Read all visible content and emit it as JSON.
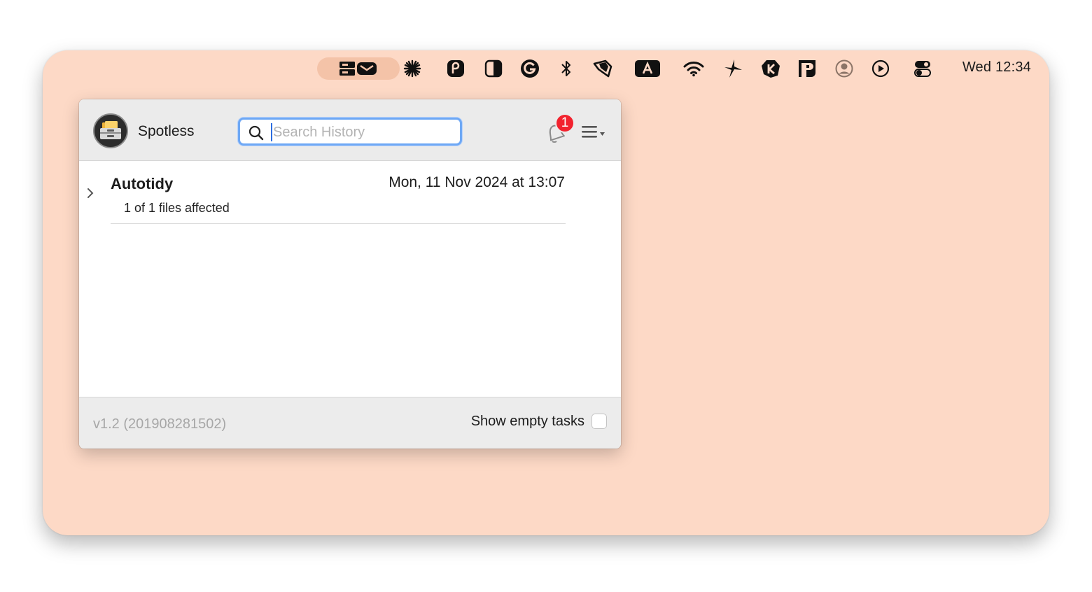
{
  "menubar": {
    "icons": [
      "spotless-mail-icon",
      "asterisk-icon",
      "pastebot-icon",
      "contrast-icon",
      "grammarly-icon",
      "bluetooth-icon",
      "shield-icon",
      "font-a-icon",
      "wifi-icon",
      "spark-icon",
      "keystroke-icon",
      "paste-icon",
      "user-circle-icon",
      "play-icon",
      "control-center-icon"
    ],
    "clock": "Wed 12:34"
  },
  "popover": {
    "app_name": "Spotless",
    "search": {
      "placeholder": "Search History",
      "value": ""
    },
    "notification_count": "1",
    "history": [
      {
        "title": "Autotidy",
        "date": "Mon, 11 Nov 2024 at 13:07",
        "subtitle": "1 of 1 files affected"
      }
    ],
    "footer": {
      "version": "v1.2 (201908281502)",
      "show_empty_label": "Show empty tasks",
      "show_empty_checked": false
    }
  },
  "colors": {
    "desktop": "#fdd9c6",
    "badge": "#f2222e",
    "focus_ring": "#6ea8f5"
  }
}
